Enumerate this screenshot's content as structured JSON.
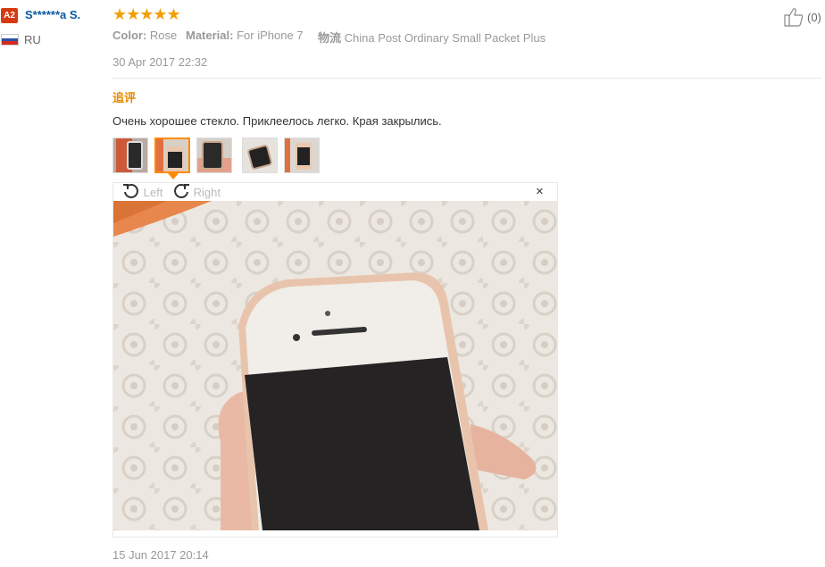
{
  "user": {
    "level_badge": "A2",
    "name": "S******a S.",
    "country": "RU",
    "flag_colors": [
      "#ffffff",
      "#2d4fa8",
      "#d52b1e"
    ]
  },
  "review": {
    "stars_display": "★★★★★",
    "rating": 5,
    "color_label": "Color:",
    "color_value": "Rose",
    "material_label": "Material:",
    "material_value": "For iPhone 7",
    "shipping_label": "物流",
    "shipping_value": "China Post Ordinary Small Packet Plus",
    "date": "30 Apr 2017 22:32",
    "helpful_count": "(0)"
  },
  "followup": {
    "heading": "追评",
    "text": "Очень хорошее стекло. Приклеелось легко. Края закрылись.",
    "thumbnail_count": 5,
    "active_thumbnail": 2,
    "rotate_left_label": "Left",
    "rotate_right_label": "Right",
    "close_symbol": "×",
    "date": "15 Jun 2017 20:14"
  },
  "colors": {
    "star": "#f29f05",
    "username": "#0a5aa0",
    "followup_heading": "#e68a00",
    "active_border": "#ff8a00",
    "badge": "#d43a12"
  }
}
